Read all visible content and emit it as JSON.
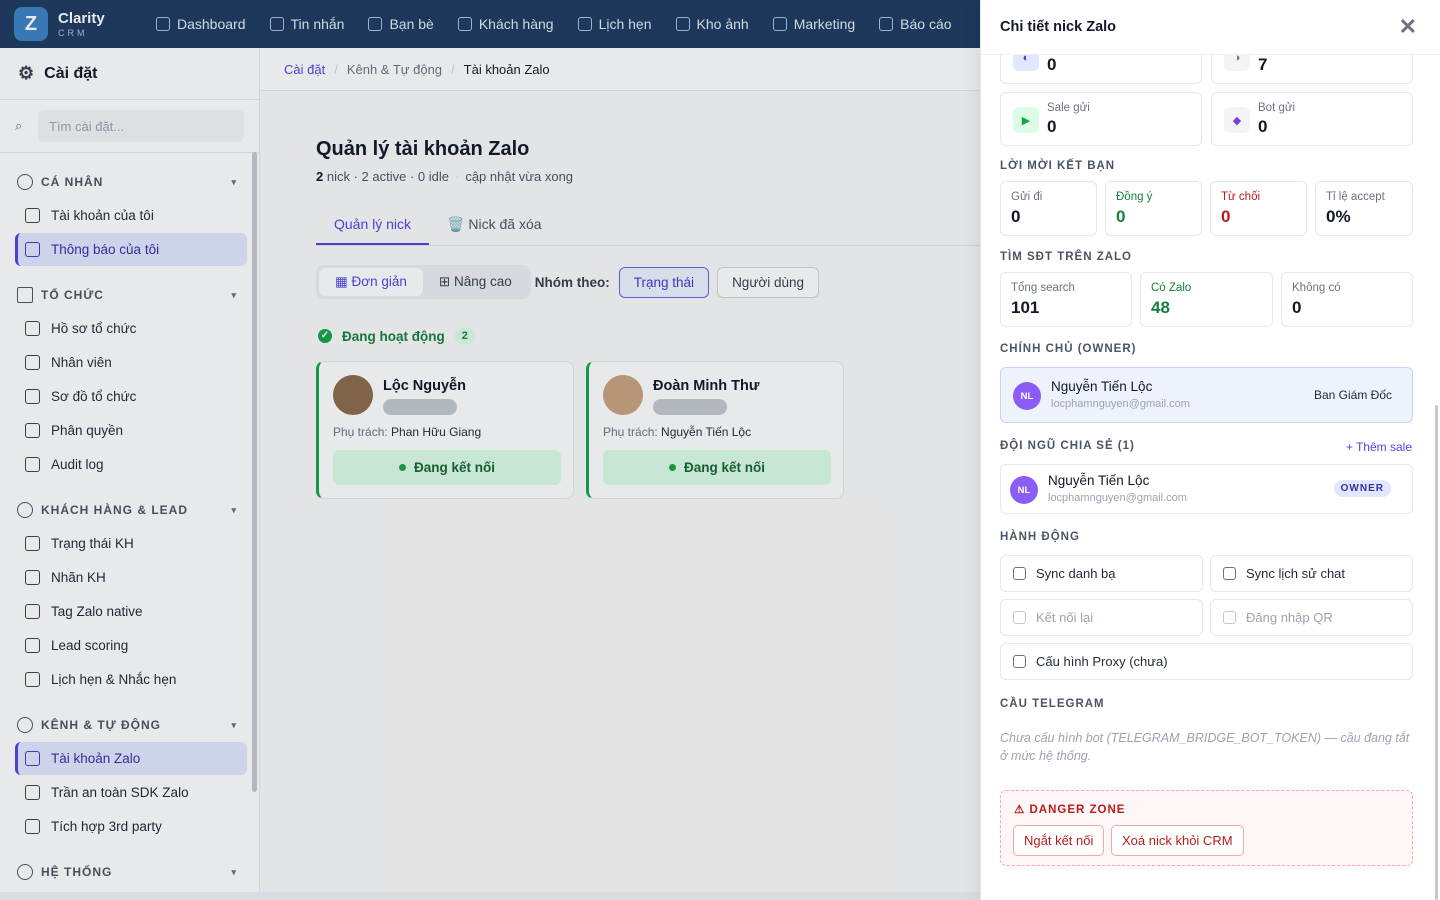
{
  "app": {
    "logo_letter": "Z",
    "name": "Clarity",
    "sub": "CRM"
  },
  "nav": [
    "Dashboard",
    "Tin nhắn",
    "Bạn bè",
    "Khách hàng",
    "Lịch hẹn",
    "Kho ảnh",
    "Marketing",
    "Báo cáo"
  ],
  "sidebar": {
    "title": "Cài đặt",
    "search_placeholder": "Tìm cài đặt...",
    "sections": [
      {
        "title": "CÁ NHÂN",
        "items": [
          "Tài khoản của tôi",
          "Thông báo của tôi"
        ]
      },
      {
        "title": "TỔ CHỨC",
        "items": [
          "Hồ sơ tổ chức",
          "Nhân viên",
          "Sơ đồ tổ chức",
          "Phân quyền",
          "Audit log"
        ]
      },
      {
        "title": "KHÁCH HÀNG & LEAD",
        "items": [
          "Trạng thái KH",
          "Nhãn KH",
          "Tag Zalo native",
          "Lead scoring",
          "Lịch hẹn & Nhắc hẹn"
        ]
      },
      {
        "title": "KÊNH & TỰ ĐỘNG",
        "items": [
          "Tài khoản Zalo",
          "Trần an toàn SDK Zalo",
          "Tích hợp 3rd party"
        ]
      },
      {
        "title": "HỆ THỐNG",
        "items": []
      }
    ]
  },
  "breadcrumb": [
    "Cài đặt",
    "Kênh & Tự động",
    "Tài khoản Zalo"
  ],
  "page": {
    "title": "Quản lý tài khoản Zalo",
    "sub_count": "2",
    "sub_rest": "nick · 2 active · 0 idle",
    "sub_updated": "cập nhật vừa xong",
    "tabs": [
      "Quản lý nick",
      "🗑️ Nick đã xóa"
    ],
    "view_modes": [
      "Đơn giản",
      "Nâng cao"
    ],
    "group_by_label": "Nhóm theo:",
    "group_by_options": [
      "Trạng thái",
      "Người dùng"
    ],
    "group_title": "Đang hoạt động",
    "group_count": "2",
    "resp_label": "Phụ trách:",
    "cards": [
      {
        "name": "Lộc Nguyễn",
        "resp": "Phan Hữu Giang",
        "status": "Đang kết nối"
      },
      {
        "name": "Đoàn Minh Thư",
        "resp": "Nguyễn Tiến Lộc",
        "status": "Đang kết nối"
      }
    ]
  },
  "drawer": {
    "title": "Chi tiết nick Zalo",
    "close": "✕",
    "top_stats": [
      {
        "value": "0"
      },
      {
        "value": "7"
      },
      {
        "label": "Sale gửi",
        "value": "0"
      },
      {
        "label": "Bot gửi",
        "value": "0"
      }
    ],
    "friend_title": "LỜI MỜI KẾT BẠN",
    "friend": [
      {
        "label": "Gửi đi",
        "value": "0"
      },
      {
        "label": "Đồng ý",
        "value": "0"
      },
      {
        "label": "Từ chối",
        "value": "0"
      },
      {
        "label": "Tỉ lệ accept",
        "value": "0%"
      }
    ],
    "phone_title": "TÌM SĐT TRÊN ZALO",
    "phone": [
      {
        "label": "Tổng search",
        "value": "101"
      },
      {
        "label": "Có Zalo",
        "value": "48"
      },
      {
        "label": "Không có",
        "value": "0"
      }
    ],
    "owner_title": "CHÍNH CHỦ (OWNER)",
    "owner": {
      "initials": "NL",
      "name": "Nguyễn Tiến Lộc",
      "email": "locphamnguyen@gmail.com",
      "role": "Ban Giám Đốc"
    },
    "share_title": "ĐỘI NGŨ CHIA SẺ (1)",
    "add_sale": "+ Thêm sale",
    "share": {
      "initials": "NL",
      "name": "Nguyễn Tiến Lộc",
      "email": "locphamnguyen@gmail.com",
      "badge": "OWNER"
    },
    "actions_title": "HÀNH ĐỘNG",
    "actions": [
      "Sync danh bạ",
      "Sync lịch sử chat",
      "Kết nối lại",
      "Đăng nhập QR",
      "Cấu hình Proxy (chưa)"
    ],
    "telegram_title": "CẦU TELEGRAM",
    "telegram_note": "Chưa cấu hình bot (TELEGRAM_BRIDGE_BOT_TOKEN) — cầu đang tắt ở mức hệ thống.",
    "danger_title": "⚠ DANGER ZONE",
    "danger_buttons": [
      "Ngắt kết nối",
      "Xoá nick khỏi CRM"
    ]
  }
}
